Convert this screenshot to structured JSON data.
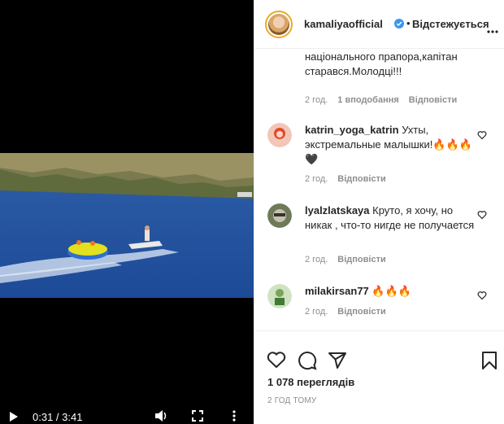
{
  "video": {
    "time": "0:31 / 3:41"
  },
  "post": {
    "username": "kamaliyaofficial",
    "dot": "•",
    "follow_label": "Відстежується",
    "views": "1 078 переглядів",
    "posted_ago": "2 ГОД ТОМУ"
  },
  "comments": [
    {
      "text": "національного прапора,капітан старався.Молодці!!!",
      "time": "2 год.",
      "likes": "1 вподобання",
      "reply": "Відповісти"
    },
    {
      "user": "katrin_yoga_katrin",
      "text": " Ухты, экстремальные малышки!🔥🔥🔥🖤",
      "time": "2 год.",
      "reply": "Відповісти"
    },
    {
      "user": "lyalzlatskaya",
      "text": " Круто, я хочу, но никак , что-то нигде не получается",
      "time": "2 год.",
      "reply": "Відповісти"
    },
    {
      "user": "milakirsan77",
      "text": " 🔥🔥🔥",
      "time": "2 год.",
      "reply": "Відповісти"
    }
  ],
  "colors": {
    "accent_ring": "#e8aa2c",
    "verified_blue": "#3897f0",
    "muted_text": "#8e8e8e"
  }
}
